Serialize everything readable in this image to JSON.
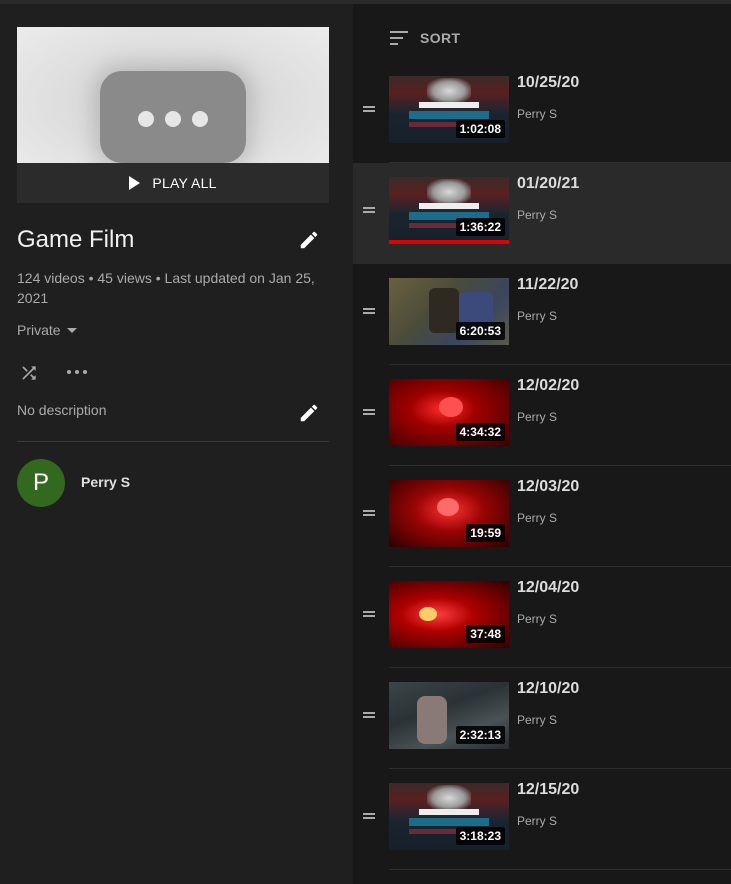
{
  "playlist": {
    "play_all_label": "PLAY ALL",
    "title": "Game Film",
    "meta": "124 videos • 45 views • Last updated on Jan 25, 2021",
    "privacy": "Private",
    "description": "No description",
    "owner": {
      "initial": "P",
      "name": "Perry S",
      "avatar_color": "#33691e"
    }
  },
  "list": {
    "sort_label": "SORT",
    "items": [
      {
        "title": "10/25/20",
        "channel": "Perry S",
        "duration": "1:02:08"
      },
      {
        "title": "01/20/21",
        "channel": "Perry S",
        "duration": "1:36:22",
        "watched_fraction": 1.0
      },
      {
        "title": "11/22/20",
        "channel": "Perry S",
        "duration": "6:20:53"
      },
      {
        "title": "12/02/20",
        "channel": "Perry S",
        "duration": "4:34:32"
      },
      {
        "title": "12/03/20",
        "channel": "Perry S",
        "duration": "19:59"
      },
      {
        "title": "12/04/20",
        "channel": "Perry S",
        "duration": "37:48"
      },
      {
        "title": "12/10/20",
        "channel": "Perry S",
        "duration": "2:32:13"
      },
      {
        "title": "12/15/20",
        "channel": "Perry S",
        "duration": "3:18:23"
      }
    ]
  },
  "colors": {
    "accent_red": "#e00000",
    "panel_left": "#1f1f1f",
    "panel_right": "#181818"
  }
}
